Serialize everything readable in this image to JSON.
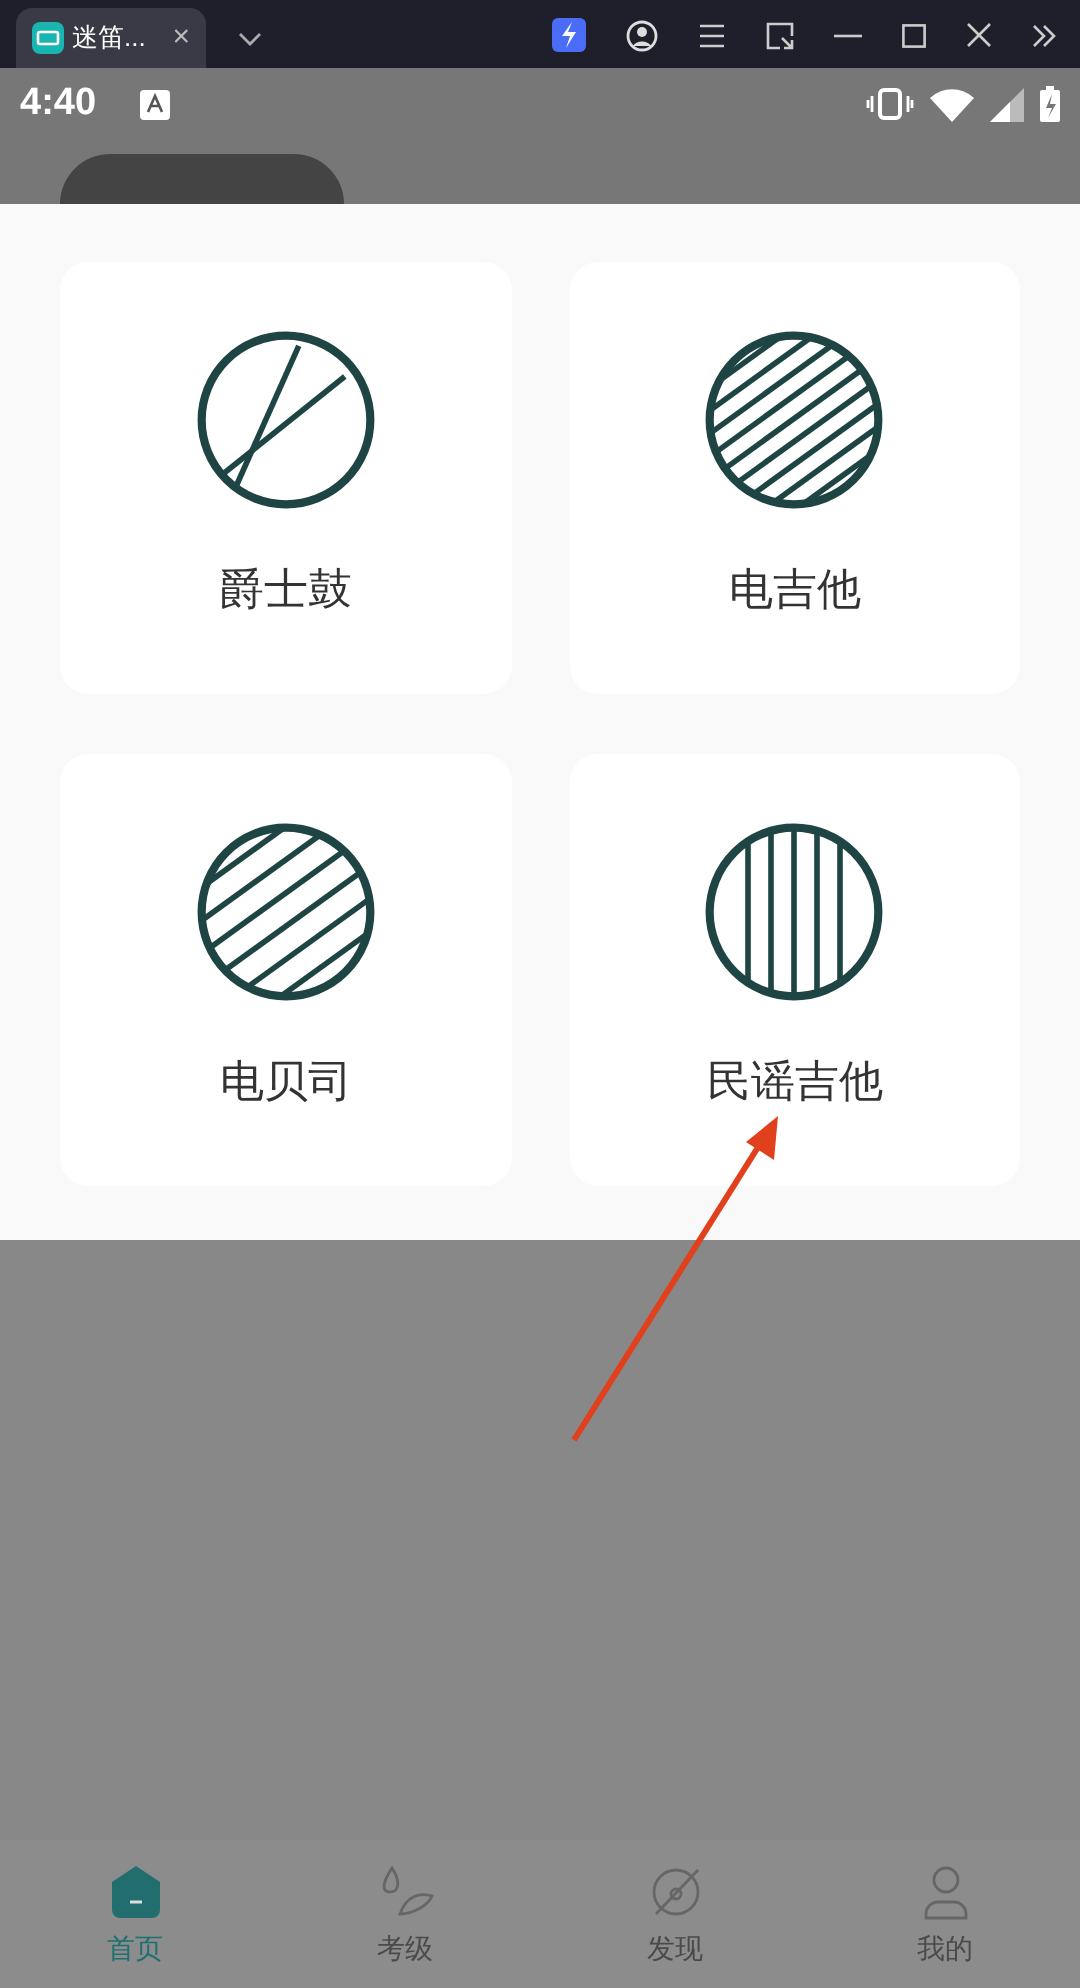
{
  "browser_tab": {
    "title": "迷笛...",
    "close": "×"
  },
  "status_bar": {
    "time": "4:40"
  },
  "instruments": [
    {
      "label": "爵士鼓",
      "kind": "cross"
    },
    {
      "label": "电吉他",
      "kind": "dense"
    },
    {
      "label": "电贝司",
      "kind": "sparse"
    },
    {
      "label": "民谣吉他",
      "kind": "vertical"
    }
  ],
  "nav": [
    {
      "label": "首页",
      "selected": true
    },
    {
      "label": "考级",
      "selected": false
    },
    {
      "label": "发现",
      "selected": false
    },
    {
      "label": "我的",
      "selected": false
    }
  ]
}
